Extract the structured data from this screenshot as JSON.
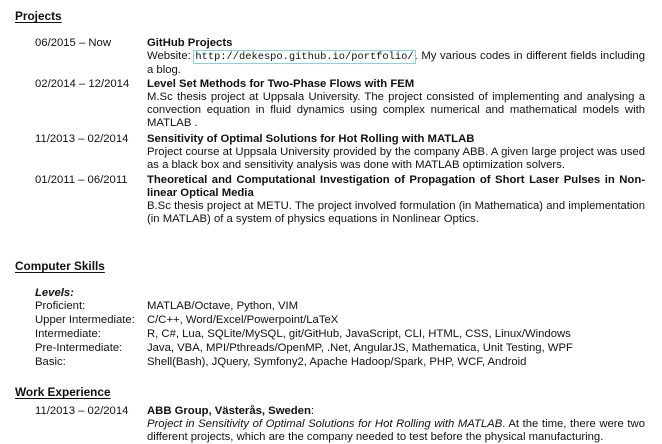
{
  "projects": {
    "heading": "Projects",
    "items": [
      {
        "date": "06/2015 – Now",
        "title": "GitHub Projects",
        "website_label": "Website:",
        "url": "http://dekespo.github.io/portfolio/",
        "after_url": ". My various codes in different fields including a blog."
      },
      {
        "date": "02/2014 – 12/2014",
        "title": "Level Set Methods for Two-Phase Flows with FEM",
        "description": "M.Sc thesis project at Uppsala University. The project consisted of implementing and analysing a convection equation in fluid dynamics using complex numerical and mathematical models with MATLAB ."
      },
      {
        "date": "11/2013 – 02/2014",
        "title": "Sensitivity of Optimal Solutions for Hot Rolling with MATLAB",
        "description": "Project course at Uppsala University provided by the company ABB. A given large project was used as a black box and sensitivity analysis was done with MATLAB optimization solvers."
      },
      {
        "date": "01/2011 – 06/2011",
        "title": "Theoretical and Computational Investigation of Propagation of Short Laser Pulses in Non-linear Optical Media",
        "description": "B.Sc thesis project at METU. The project involved formulation (in Mathematica) and implementation (in MATLAB) of a system of physics equations in Nonlinear Optics."
      }
    ]
  },
  "computer_skills": {
    "heading": "Computer Skills",
    "levels_label": "Levels:",
    "rows": [
      {
        "level": "Proficient:",
        "items": "MATLAB/Octave, Python, VIM"
      },
      {
        "level": "Upper Intermediate:",
        "items": "C/C++, Word/Excel/Powerpoint/LaTeX"
      },
      {
        "level": "Intermediate:",
        "items": "R, C#, Lua, SQLite/MySQL, git/GitHub, JavaScript, CLI, HTML, CSS, Linux/Windows"
      },
      {
        "level": "Pre-Intermediate:",
        "items": "Java, VBA, MPI/Pthreads/OpenMP, .Net, AngularJS, Mathematica, Unit Testing, WPF"
      },
      {
        "level": "Basic:",
        "items": "Shell(Bash), JQuery, Symfony2, Apache Hadoop/Spark, PHP, WCF, Android"
      }
    ]
  },
  "work_experience": {
    "heading": "Work Experience",
    "items": [
      {
        "date": "11/2013 – 02/2014",
        "employer": "ABB Group, Västerås, Sweden",
        "employer_suffix": ":",
        "project_italic": "Project in Sensitivity of Optimal Solutions for Hot Rolling with MATLAB",
        "description": ". At the time, there were two different projects, which are the company needed to test before the physical manufacturing."
      }
    ]
  }
}
